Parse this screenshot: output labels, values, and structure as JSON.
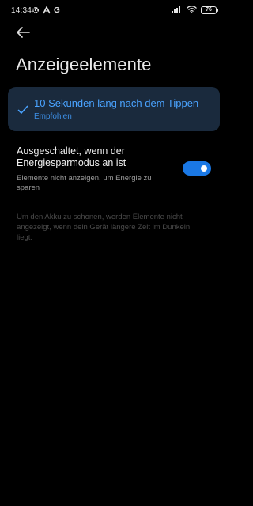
{
  "status_bar": {
    "time": "14:34",
    "left_icons": [
      "gear-icon",
      "signal-a-icon"
    ],
    "g_label": "G",
    "right_icons": [
      "signal-bars-icon",
      "wifi-icon"
    ],
    "battery_level": "76"
  },
  "header": {
    "back_icon": "arrow-left-icon",
    "title": "Anzeigeelemente"
  },
  "selected_option": {
    "label": "10 Sekunden lang nach dem Tippen",
    "sublabel": "Empfohlen",
    "checked": true
  },
  "power_saving_setting": {
    "title": "Ausgeschaltet, wenn der Energiesparmodus an ist",
    "description": "Elemente nicht anzeigen, um Energie zu sparen",
    "enabled": true
  },
  "footnote": "Um den Akku zu schonen, werden Elemente nicht angezeigt, wenn dein Gerät längere Zeit im Dunkeln liegt.",
  "colors": {
    "background": "#000000",
    "accent": "#4aa3ff",
    "toggle_on": "#1a78e5",
    "card_background": "#1a2a3d"
  }
}
